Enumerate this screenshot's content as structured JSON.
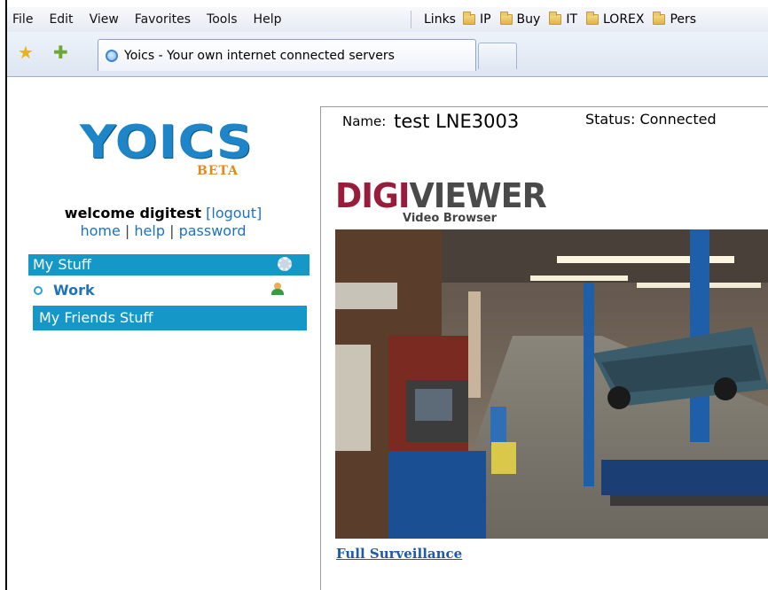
{
  "menubar": {
    "items": [
      "File",
      "Edit",
      "View",
      "Favorites",
      "Tools",
      "Help"
    ],
    "links_label": "Links",
    "links": [
      "IP",
      "Buy",
      "IT",
      "LOREX",
      "Pers"
    ]
  },
  "tab": {
    "title": "Yoics - Your own internet connected servers"
  },
  "sidebar": {
    "logo_text": "YOICS",
    "logo_beta": "BETA",
    "welcome_text": "welcome digitest",
    "logout": "[logout]",
    "links": {
      "home": "home",
      "help": "help",
      "password": "password"
    },
    "my_stuff": "My Stuff",
    "work": "Work",
    "my_friends_stuff": "My Friends Stuff"
  },
  "device": {
    "name_label": "Name:",
    "name_value": "test LNE3003",
    "status": "Status: Connected",
    "brand_left": "DIGI",
    "brand_right": "VIEWER",
    "brand_sub": "Video Browser",
    "link_full": "Full Surveillance"
  },
  "colors": {
    "accent_bar": "#1598c8",
    "link": "#1e73be",
    "logo_blue": "#1e86c8",
    "logo_orange": "#e58a1a",
    "digi_red": "#9a1c3b"
  }
}
